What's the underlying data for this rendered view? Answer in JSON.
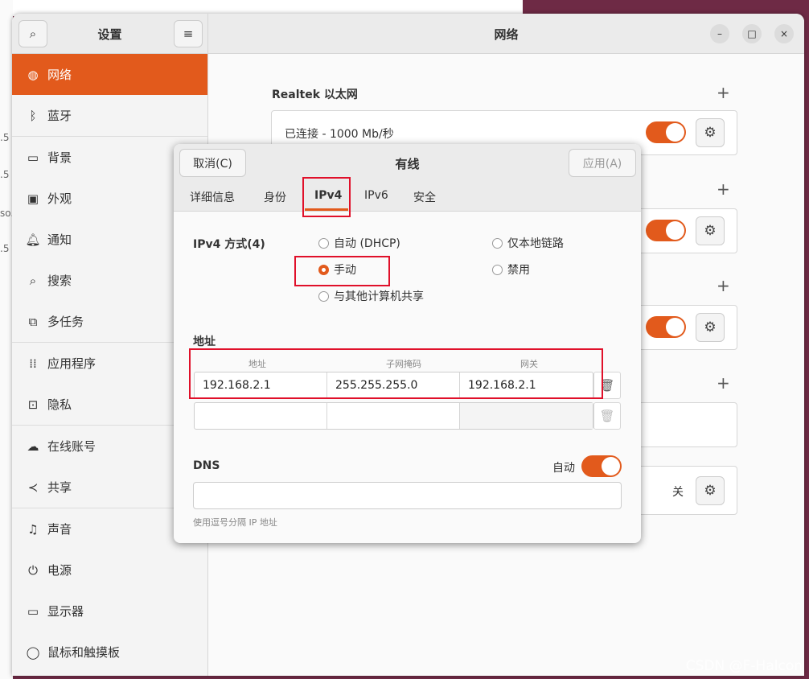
{
  "desktop": {
    "fragments": [
      ".5",
      ".5",
      "so.",
      ".5"
    ],
    "watermark": "CSDN @F-Halcon"
  },
  "window": {
    "sidebar_title": "设置",
    "title": "网络",
    "controls": [
      "–",
      "□",
      "×"
    ]
  },
  "sidebar": {
    "items": [
      {
        "label": "网络",
        "icon": "globe-icon",
        "glyph": "◍"
      },
      {
        "label": "蓝牙",
        "icon": "bluetooth-icon",
        "glyph": "ᛒ"
      },
      {
        "label": "背景",
        "icon": "monitor-icon",
        "glyph": "▭"
      },
      {
        "label": "外观",
        "icon": "appearance-icon",
        "glyph": "▣"
      },
      {
        "label": "通知",
        "icon": "bell-icon",
        "glyph": "♫"
      },
      {
        "label": "搜索",
        "icon": "search-icon",
        "glyph": "⌕"
      },
      {
        "label": "多任务",
        "icon": "multitask-icon",
        "glyph": "⧉"
      },
      {
        "label": "应用程序",
        "icon": "grid-icon",
        "glyph": "⁞⁞"
      },
      {
        "label": "隐私",
        "icon": "lock-icon",
        "glyph": "⊡"
      },
      {
        "label": "在线账号",
        "icon": "cloud-icon",
        "glyph": "☁"
      },
      {
        "label": "共享",
        "icon": "share-icon",
        "glyph": "≺"
      },
      {
        "label": "声音",
        "icon": "music-icon",
        "glyph": "♫"
      },
      {
        "label": "电源",
        "icon": "power-icon",
        "glyph": "⏻"
      },
      {
        "label": "显示器",
        "icon": "display-icon",
        "glyph": "▭"
      },
      {
        "label": "鼠标和触摸板",
        "icon": "mouse-icon",
        "glyph": "◯"
      }
    ]
  },
  "network": {
    "wired_title": "Realtek 以太网",
    "wired_status": "已连接 - 1000 Mb/秒",
    "plus": "+",
    "proxy_status": "关"
  },
  "dialog": {
    "cancel": "取消(C)",
    "title": "有线",
    "apply": "应用(A)",
    "tabs": [
      "详细信息",
      "身份",
      "IPv4",
      "IPv6",
      "安全"
    ],
    "active_tab": "IPv4",
    "method_label": "IPv4 方式(4)",
    "methods": {
      "auto": "自动 (DHCP)",
      "link_local": "仅本地链路",
      "manual": "手动",
      "disabled": "禁用",
      "shared": "与其他计算机共享"
    },
    "selected_method": "手动",
    "address_label": "地址",
    "columns": [
      "地址",
      "子网掩码",
      "网关"
    ],
    "rows": [
      {
        "address": "192.168.2.1",
        "netmask": "255.255.255.0",
        "gateway": "192.168.2.1"
      },
      {
        "address": "",
        "netmask": "",
        "gateway": ""
      }
    ],
    "dns_label": "DNS",
    "dns_auto_label": "自动",
    "dns_auto": true,
    "dns_value": "",
    "dns_hint": "使用逗号分隔 IP 地址"
  },
  "colors": {
    "accent": "#e25a1c",
    "annotation": "#e0102a"
  }
}
